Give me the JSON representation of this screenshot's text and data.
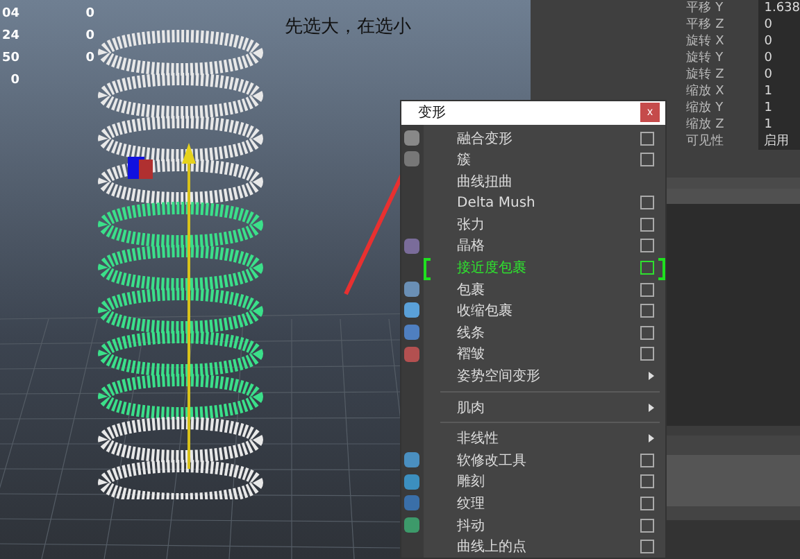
{
  "hud": {
    "column_1": [
      "04",
      "24",
      "50",
      "0"
    ],
    "column_2": [
      "0",
      "0",
      "0"
    ]
  },
  "annotation": "先选大，在选小",
  "channel_box": [
    {
      "label": "平移 Y",
      "value": "1.638"
    },
    {
      "label": "平移 Z",
      "value": "0"
    },
    {
      "label": "旋转 X",
      "value": "0"
    },
    {
      "label": "旋转 Y",
      "value": "0"
    },
    {
      "label": "旋转 Z",
      "value": "0"
    },
    {
      "label": "缩放 X",
      "value": "1"
    },
    {
      "label": "缩放 Y",
      "value": "1"
    },
    {
      "label": "缩放 Z",
      "value": "1"
    },
    {
      "label": "可见性",
      "value": "启用"
    }
  ],
  "menu": {
    "title": "变形",
    "close": "x",
    "items": [
      {
        "kind": "check",
        "label": "融合变形",
        "checked": false,
        "highlighted": false
      },
      {
        "kind": "check",
        "label": "簇",
        "checked": false,
        "highlighted": false
      },
      {
        "kind": "plain",
        "label": "曲线扭曲",
        "highlighted": false
      },
      {
        "kind": "check",
        "label": "Delta Mush",
        "checked": false,
        "highlighted": false
      },
      {
        "kind": "check",
        "label": "张力",
        "checked": false,
        "highlighted": false
      },
      {
        "kind": "check",
        "label": "晶格",
        "checked": false,
        "highlighted": false
      },
      {
        "kind": "check",
        "label": "接近度包裹",
        "checked": false,
        "highlighted": true
      },
      {
        "kind": "check",
        "label": "包裹",
        "checked": false,
        "highlighted": false
      },
      {
        "kind": "check",
        "label": "收缩包裹",
        "checked": false,
        "highlighted": false
      },
      {
        "kind": "check",
        "label": "线条",
        "checked": false,
        "highlighted": false
      },
      {
        "kind": "check",
        "label": "褶皱",
        "checked": false,
        "highlighted": false
      },
      {
        "kind": "submenu",
        "label": "姿势空间变形",
        "highlighted": false
      },
      {
        "kind": "separator"
      },
      {
        "kind": "submenu",
        "label": "肌肉",
        "highlighted": false
      },
      {
        "kind": "separator"
      },
      {
        "kind": "submenu",
        "label": "非线性",
        "highlighted": false
      },
      {
        "kind": "check",
        "label": "软修改工具",
        "checked": false,
        "highlighted": false
      },
      {
        "kind": "check",
        "label": "雕刻",
        "checked": false,
        "highlighted": false
      },
      {
        "kind": "check",
        "label": "纹理",
        "checked": false,
        "highlighted": false
      },
      {
        "kind": "check",
        "label": "抖动",
        "checked": false,
        "highlighted": false
      },
      {
        "kind": "check",
        "label": "曲线上的点",
        "checked": false,
        "highlighted": false
      }
    ]
  }
}
